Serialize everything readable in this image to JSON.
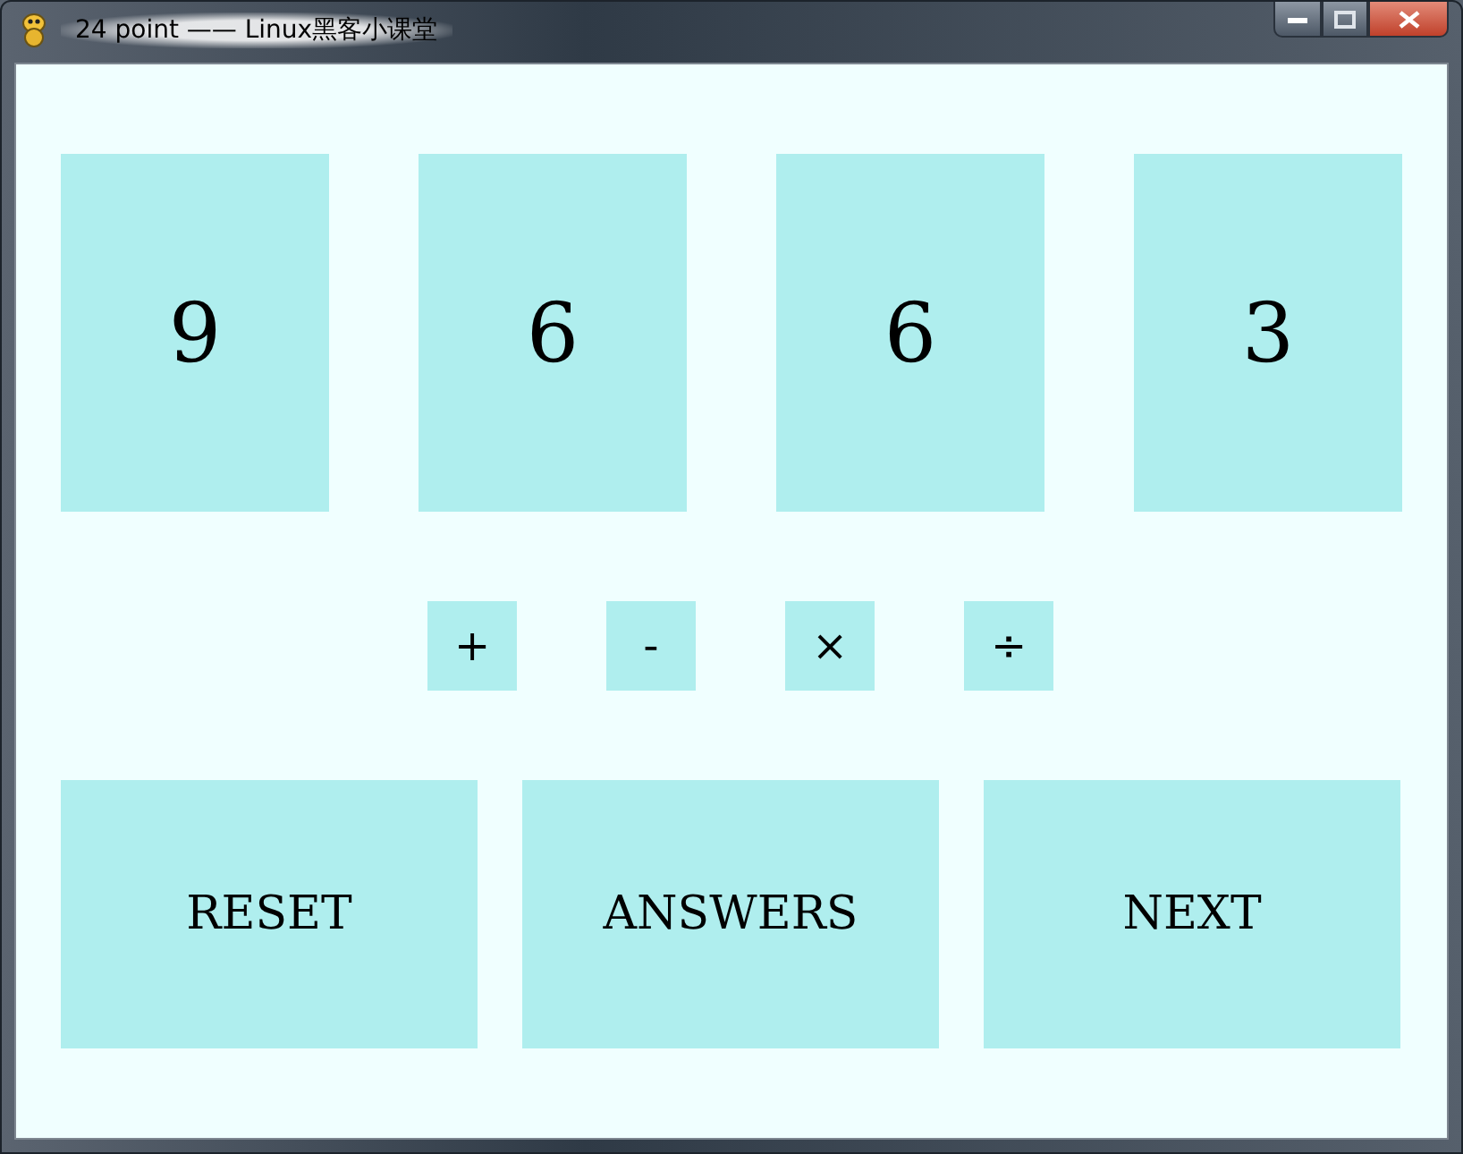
{
  "window": {
    "title": "24 point —— Linux黑客小课堂"
  },
  "cards": [
    "9",
    "6",
    "6",
    "3"
  ],
  "operators": [
    "+",
    "-",
    "×",
    "÷"
  ],
  "buttons": [
    "RESET",
    "ANSWERS",
    "NEXT"
  ]
}
